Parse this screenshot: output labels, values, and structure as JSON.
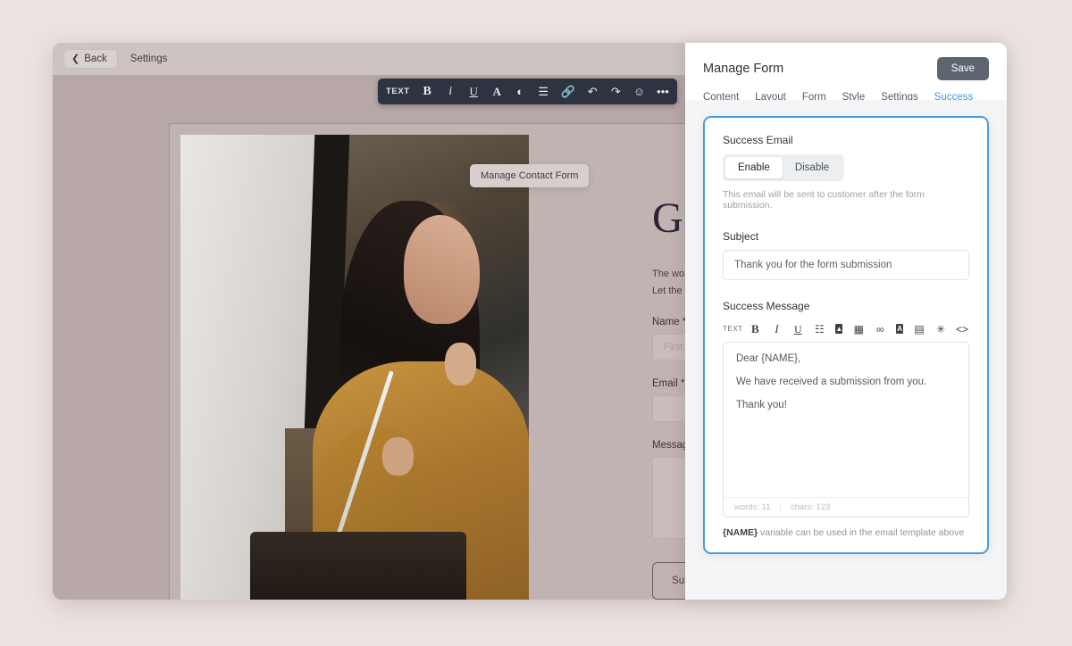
{
  "editor": {
    "back_label": "Back",
    "page_title": "Settings",
    "back_icon": "chevron-left-icon",
    "format_toolbar": [
      {
        "name": "text-style-icon",
        "glyph": "TEXT",
        "kind": "lbl"
      },
      {
        "name": "bold-icon",
        "glyph": "B",
        "kind": "b"
      },
      {
        "name": "italic-icon",
        "glyph": "i",
        "kind": "i"
      },
      {
        "name": "underline-icon",
        "glyph": "U",
        "kind": "u"
      },
      {
        "name": "font-color-icon",
        "glyph": "A",
        "kind": "aa"
      },
      {
        "name": "contrast-icon",
        "glyph": "◐",
        "kind": ""
      },
      {
        "name": "align-icon",
        "glyph": "☰",
        "kind": ""
      },
      {
        "name": "link-icon",
        "glyph": "🔗",
        "kind": ""
      },
      {
        "name": "undo-icon",
        "glyph": "↶",
        "kind": ""
      },
      {
        "name": "redo-icon",
        "glyph": "↷",
        "kind": ""
      },
      {
        "name": "emoji-icon",
        "glyph": "☺",
        "kind": ""
      },
      {
        "name": "more-options-icon",
        "glyph": "•••",
        "kind": ""
      }
    ],
    "tooltip": "Manage Contact Form"
  },
  "page": {
    "headline": "Get i",
    "paragraph_line1": "The world is a place wit",
    "paragraph_line2": "Let the call to create so",
    "fields": [
      {
        "label": "Name *",
        "placeholder": "First Name",
        "type": "input"
      },
      {
        "label": "Email *",
        "placeholder": "",
        "type": "input"
      },
      {
        "label": "Message *",
        "placeholder": "",
        "type": "textarea"
      }
    ],
    "submit_label": "Submit"
  },
  "panel": {
    "title": "Manage Form",
    "save_label": "Save",
    "tabs": [
      {
        "label": "Content",
        "active": false
      },
      {
        "label": "Layout",
        "active": false
      },
      {
        "label": "Form",
        "active": false
      },
      {
        "label": "Style",
        "active": false
      },
      {
        "label": "Settings",
        "active": false
      },
      {
        "label": "Success Email",
        "active": true
      }
    ],
    "success_email": {
      "section_label": "Success Email",
      "toggle": {
        "enable_label": "Enable",
        "disable_label": "Disable",
        "selected": "Enable"
      },
      "hint": "This email will be sent to customer after the form submission.",
      "subject_label": "Subject",
      "subject_value": "Thank you for the form submission",
      "message_label": "Success Message",
      "rte_toolbar": [
        {
          "name": "text-style-icon",
          "glyph": "TEXT",
          "kind": "lbl"
        },
        {
          "name": "bold-icon",
          "glyph": "B",
          "kind": "b"
        },
        {
          "name": "italic-icon",
          "glyph": "I",
          "kind": "i"
        },
        {
          "name": "underline-icon",
          "glyph": "U",
          "kind": "u"
        },
        {
          "name": "bullet-list-icon",
          "glyph": "☷",
          "kind": ""
        },
        {
          "name": "image-icon",
          "glyph": "▣",
          "kind": "sq-img"
        },
        {
          "name": "gallery-icon",
          "glyph": "▦",
          "kind": ""
        },
        {
          "name": "link-icon",
          "glyph": "∞",
          "kind": ""
        },
        {
          "name": "text-color-icon",
          "glyph": "A",
          "kind": "sq-a"
        },
        {
          "name": "background-icon",
          "glyph": "▤",
          "kind": ""
        },
        {
          "name": "effects-icon",
          "glyph": "✳",
          "kind": ""
        },
        {
          "name": "html-code-icon",
          "glyph": "<>",
          "kind": ""
        }
      ],
      "message_lines": [
        "Dear {NAME},",
        "We have received a submission from you.",
        "Thank you!"
      ],
      "words_count": "words: 11",
      "chars_count": "chars: 123",
      "note_variable": "{NAME}",
      "note_text": " variable can be used in the email template above"
    }
  },
  "colors": {
    "accent_blue": "#4a9ae1",
    "save_gray": "#5d6670",
    "panel_bg": "#f4f5f6",
    "canvas_bg": "#b7a8a7",
    "page_bg": "#ece3e1"
  }
}
